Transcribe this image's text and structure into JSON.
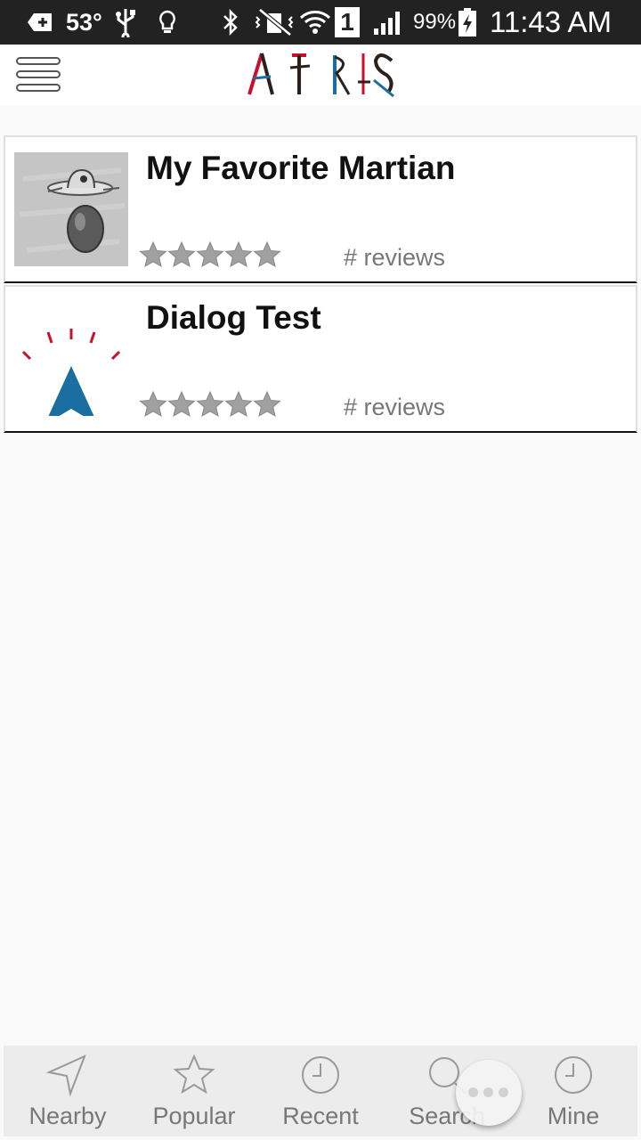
{
  "status_bar": {
    "temperature": "53°",
    "battery": "99%",
    "sim_slot": "1",
    "time": "11:43 AM"
  },
  "header": {
    "logo_text": "ARIS",
    "menu_icon": "hamburger-icon"
  },
  "games": [
    {
      "title": "My Favorite Martian",
      "thumbnail_icon": "martian-ufo-sketch",
      "rating": 0,
      "reviews_label": "# reviews"
    },
    {
      "title": "Dialog Test",
      "thumbnail_icon": "aris-arrow-logo",
      "rating": 0,
      "reviews_label": "# reviews"
    }
  ],
  "bottom_nav": {
    "items": [
      {
        "label": "Nearby",
        "icon": "navigation-arrow-icon"
      },
      {
        "label": "Popular",
        "icon": "star-icon"
      },
      {
        "label": "Recent",
        "icon": "clock-icon"
      },
      {
        "label": "Search",
        "icon": "magnifier-icon"
      },
      {
        "label": "Mine",
        "icon": "clock-icon"
      }
    ],
    "overflow_icon": "more-dots-icon"
  },
  "colors": {
    "status_bar": "#222222",
    "logo_red": "#c8102e",
    "logo_blue": "#1a6fa0",
    "logo_dark": "#2b2118",
    "star_gray": "#9e9e9e",
    "nav_background": "#ececec"
  }
}
